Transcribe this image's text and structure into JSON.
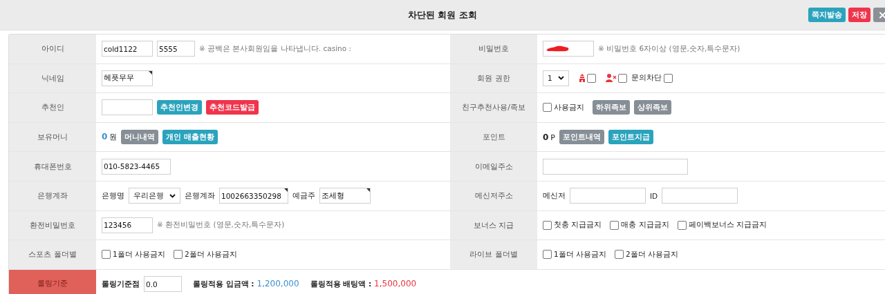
{
  "window": {
    "title": "차단된 회원 조회",
    "buttons": [
      {
        "label": "쪽지발송"
      },
      {
        "label": "저장"
      },
      {
        "label": "×"
      }
    ]
  },
  "rows": [
    {
      "cells": [
        {
          "label": "아이디",
          "highlighted": false,
          "items": [
            {
              "kind": "input",
              "value": "cold1122"
            },
            {
              "kind": "input-short",
              "value": "5555"
            },
            {
              "kind": "note",
              "text": "※ 공백은 본사회원임을 나타냅니다. casino :"
            }
          ]
        },
        {
          "label": "비밀번호",
          "highlighted": false,
          "items": [
            {
              "kind": "masked"
            },
            {
              "kind": "note",
              "text": "※ 비밀번호 6자이상 (영문,숫자,특수문자)"
            }
          ]
        }
      ]
    },
    {
      "cells": [
        {
          "label": "닉네임",
          "highlighted": false,
          "items": [
            {
              "kind": "input",
              "value": "헤픗무무",
              "corner_mark": true
            }
          ]
        },
        {
          "label": "회원 권한",
          "highlighted": false,
          "items": [
            {
              "kind": "select",
              "value": "1"
            },
            {
              "kind": "icon-check",
              "checked": false
            },
            {
              "kind": "icon-check",
              "checked": false
            },
            {
              "kind": "label-check",
              "label": "문의차단",
              "checked": false
            }
          ]
        }
      ]
    },
    {
      "cells": [
        {
          "label": "추천인",
          "highlighted": false,
          "items": [
            {
              "kind": "input",
              "value": ""
            },
            {
              "kind": "teal-button",
              "label": "추천인변경"
            },
            {
              "kind": "alert-button",
              "label": "추천코드발급"
            }
          ]
        },
        {
          "label": "친구추천사용/족보",
          "highlighted": false,
          "items": [
            {
              "kind": "check",
              "label": "사용금지",
              "checked": false
            },
            {
              "kind": "plain-button",
              "label": "하위족보"
            },
            {
              "kind": "plain-button",
              "label": "상위족보"
            }
          ]
        }
      ]
    },
    {
      "cells": [
        {
          "label": "보유머니",
          "highlighted": false,
          "items": [
            {
              "kind": "amount",
              "value": "0",
              "unit": "원",
              "color": "#3a8fd0"
            },
            {
              "kind": "plain-button",
              "label": "머니내역"
            },
            {
              "kind": "teal-button",
              "label": "개인 매출현황"
            }
          ]
        },
        {
          "label": "포인트",
          "highlighted": false,
          "items": [
            {
              "kind": "amount",
              "value": "0",
              "unit": "P",
              "color": "#222222"
            },
            {
              "kind": "plain-button",
              "label": "포인트내역"
            },
            {
              "kind": "teal-button",
              "label": "포인트지급"
            }
          ]
        }
      ]
    },
    {
      "cells": [
        {
          "label": "휴대폰번호",
          "highlighted": false,
          "items": [
            {
              "kind": "input-medium",
              "value": "010-5823-4465"
            }
          ]
        },
        {
          "label": "이메일주소",
          "highlighted": false,
          "items": [
            {
              "kind": "input-wide",
              "value": ""
            }
          ]
        }
      ]
    },
    {
      "cells": [
        {
          "label": "은행계좌",
          "highlighted": false,
          "items": [
            {
              "kind": "text",
              "text": "은행명"
            },
            {
              "kind": "select",
              "value": "우리은행"
            },
            {
              "kind": "text",
              "text": "은행계좌"
            },
            {
              "kind": "input-medium",
              "value": "1002663350298",
              "corner_mark": true
            },
            {
              "kind": "text",
              "text": "예금주"
            },
            {
              "kind": "input",
              "value": "조세형",
              "corner_mark": true
            }
          ]
        },
        {
          "label": "메신저주소",
          "highlighted": false,
          "items": [
            {
              "kind": "text",
              "text": "메신저"
            },
            {
              "kind": "input-long",
              "value": ""
            },
            {
              "kind": "text",
              "text": "ID"
            },
            {
              "kind": "input-long",
              "value": ""
            }
          ]
        }
      ]
    },
    {
      "cells": [
        {
          "label": "환전비밀번호",
          "highlighted": false,
          "items": [
            {
              "kind": "input",
              "value": "123456"
            },
            {
              "kind": "note",
              "text": "※ 환전비밀번호 (영문,숫자,특수문자)"
            }
          ]
        },
        {
          "label": "보너스 지급",
          "highlighted": false,
          "items": [
            {
              "kind": "check",
              "label": "첫충 지급금지",
              "checked": false
            },
            {
              "kind": "check",
              "label": "매충 지급금지",
              "checked": false
            },
            {
              "kind": "check",
              "label": "페이백보너스 지급금지",
              "checked": false
            }
          ]
        }
      ]
    },
    {
      "cells": [
        {
          "label": "스포츠 폴더별",
          "highlighted": false,
          "items": [
            {
              "kind": "check",
              "label": "1폴더 사용금지",
              "checked": false
            },
            {
              "kind": "check",
              "label": "2폴더 사용금지",
              "checked": false
            }
          ]
        },
        {
          "label": "라이브 폴더별",
          "highlighted": false,
          "items": [
            {
              "kind": "check",
              "label": "1폴더 사용금지",
              "checked": false
            },
            {
              "kind": "check",
              "label": "2폴더 사용금지",
              "checked": false
            }
          ]
        }
      ]
    },
    {
      "cells": [
        {
          "label": "롤링기준",
          "highlighted": true,
          "items": [
            {
              "kind": "bold",
              "text": "롤링기준점"
            },
            {
              "kind": "input-short",
              "value": "0.0"
            },
            {
              "kind": "stat",
              "label": "롤링적용 입금액 :",
              "value": "1,200,000",
              "color": "#3a8fd0"
            },
            {
              "kind": "stat",
              "label": "롤링적용 배팅액 :",
              "value": "1,500,000",
              "color": "#e8343f"
            }
          ]
        }
      ]
    }
  ]
}
